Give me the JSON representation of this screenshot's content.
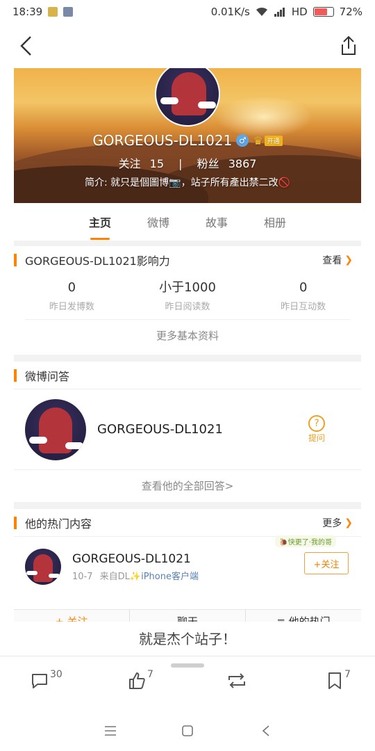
{
  "status_bar": {
    "time": "18:39",
    "network_speed": "0.01K/s",
    "hd_label": "HD",
    "battery_percent": "72%",
    "battery_level": 0.72
  },
  "nav": {
    "back_icon": "chevron-left-icon",
    "share_icon": "share-icon"
  },
  "profile": {
    "username": "GORGEOUS-DL1021",
    "vip_tag": "开通",
    "following_label": "关注",
    "following_count": "15",
    "divider": "|",
    "fans_label": "粉丝",
    "fans_count": "3867",
    "bio": "简介: 就只是個圖博📷，站子所有產出禁二改🚫"
  },
  "tabs": [
    {
      "label": "主页",
      "active": true
    },
    {
      "label": "微博",
      "active": false
    },
    {
      "label": "故事",
      "active": false
    },
    {
      "label": "相册",
      "active": false
    }
  ],
  "influence": {
    "title": "GORGEOUS-DL1021影响力",
    "view_label": "查看",
    "metrics": [
      {
        "value": "0",
        "label": "昨日发博数"
      },
      {
        "value": "小于1000",
        "label": "昨日阅读数"
      },
      {
        "value": "0",
        "label": "昨日互动数"
      }
    ],
    "more_info": "更多基本资料"
  },
  "qa": {
    "title": "微博问答",
    "name": "GORGEOUS-DL1021",
    "ask_label": "提问",
    "see_all": "查看他的全部回答>"
  },
  "hot": {
    "title": "他的热门内容",
    "more_label": "更多",
    "sticker": "🐌快更了·我的哥",
    "name": "GORGEOUS-DL1021",
    "date": "10-7",
    "source_prefix": "来自DL",
    "source_client": "✨iPhone客户端",
    "follow_label": "+关注"
  },
  "bottom_actions": {
    "follow": "+ 关注",
    "chat": "聊天",
    "hot": "≡ 他的热门"
  },
  "caption": "就是杰个站子！",
  "actions": {
    "comments": "30",
    "likes": "7",
    "reposts": "",
    "favorites": "7"
  },
  "colors": {
    "accent": "#ff8200",
    "link": "#5b7fb8",
    "battery_fill": "#f05a5a"
  }
}
